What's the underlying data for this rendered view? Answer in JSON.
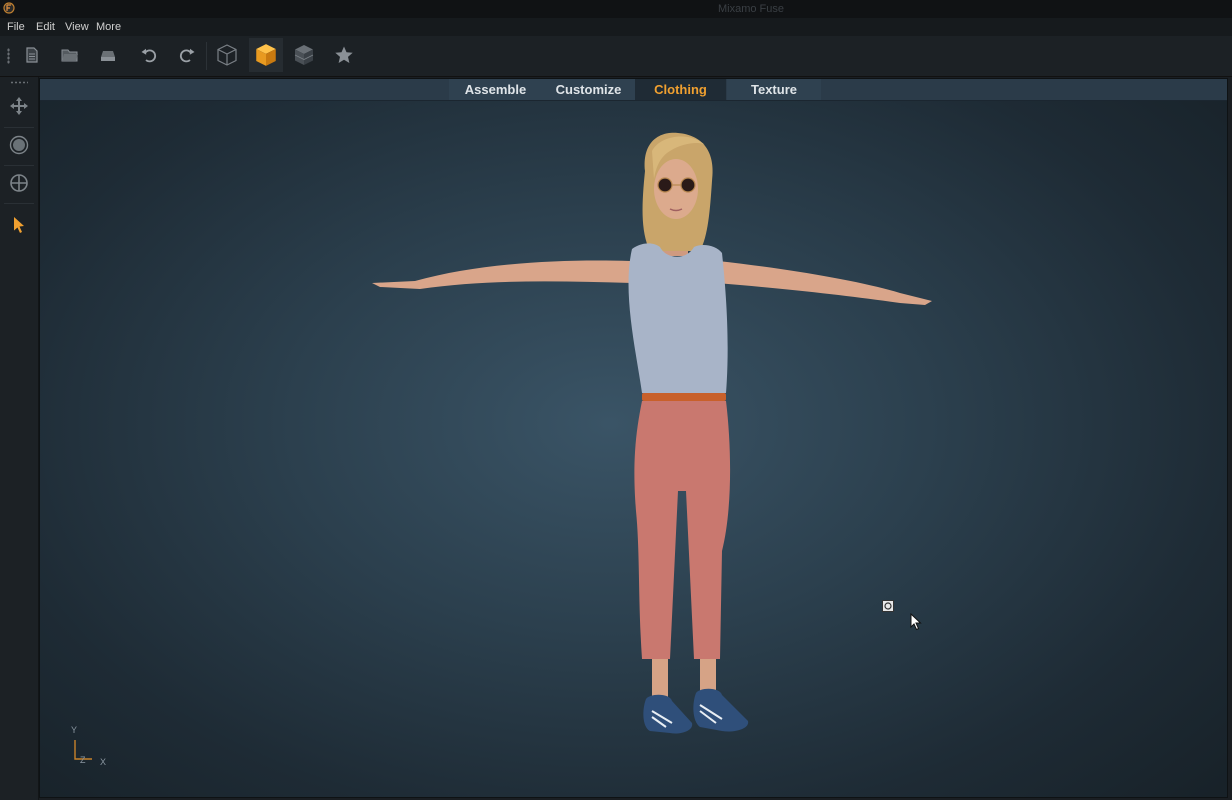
{
  "window": {
    "title": "Mixamo Fuse"
  },
  "menu": {
    "items": [
      "File",
      "Edit",
      "View",
      "More"
    ]
  },
  "toolbar": {
    "tools": [
      "new-file-icon",
      "open-folder-icon",
      "save-icon",
      "undo-icon",
      "redo-icon",
      "wireframe-cube-icon",
      "solid-cube-icon",
      "shaded-cube-icon",
      "favorite-star-icon"
    ],
    "active_tool": "solid-cube-icon",
    "accent": "#f0a030"
  },
  "sidebar": {
    "tools": [
      "move-icon",
      "rotate-icon",
      "zoom-icon",
      "select-pointer-icon"
    ],
    "active_tool": "select-pointer-icon"
  },
  "tabs": [
    {
      "label": "Assemble",
      "active": false
    },
    {
      "label": "Customize",
      "active": false
    },
    {
      "label": "Clothing",
      "active": true
    },
    {
      "label": "Texture",
      "active": false
    }
  ],
  "viewport": {
    "axis": {
      "y": "Y",
      "z": "Z",
      "x": "X"
    }
  }
}
